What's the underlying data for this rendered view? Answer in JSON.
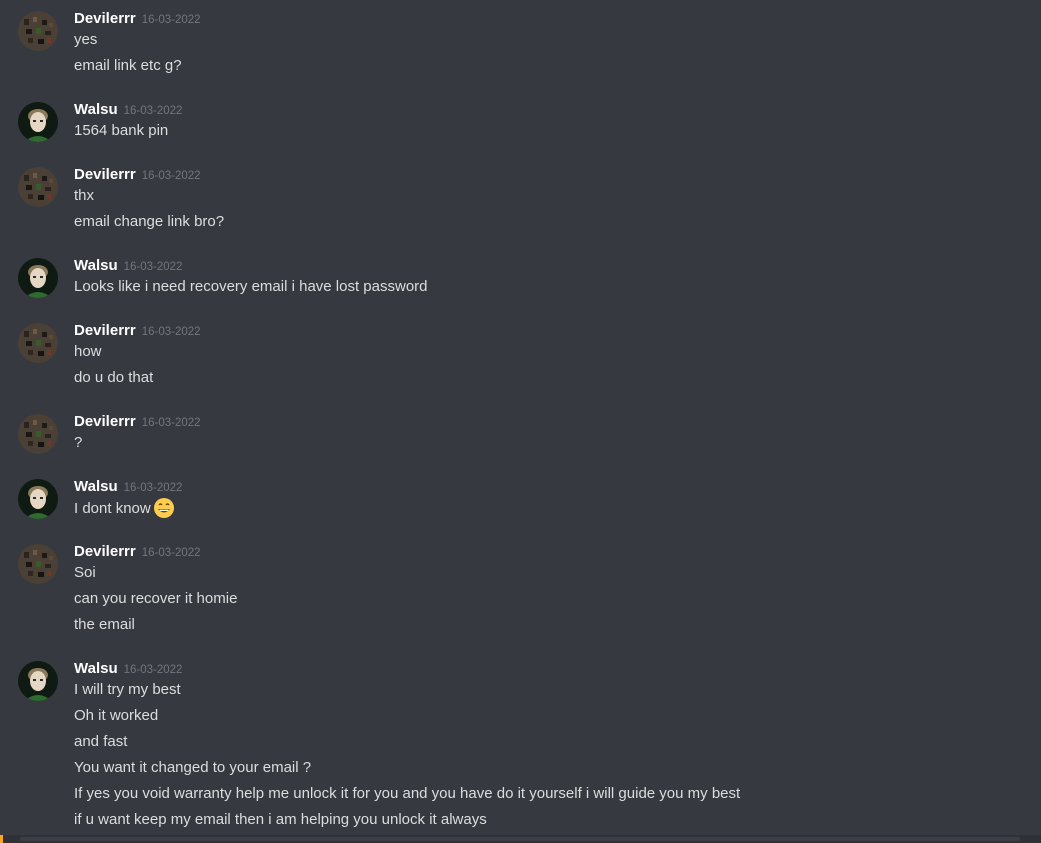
{
  "users": {
    "devilerrr": {
      "name": "Devilerrr",
      "avatar_icon": "devilerrr-avatar-icon"
    },
    "walsu": {
      "name": "Walsu",
      "avatar_icon": "walsu-avatar-icon"
    }
  },
  "colors": {
    "background": "#36393f",
    "username": "#ffffff",
    "timestamp": "#72767d",
    "message_text": "#dcddde",
    "bottom_accent": "#faa61a"
  },
  "messages": [
    {
      "author": "Devilerrr",
      "timestamp": "16-03-2022",
      "lines": [
        "yes",
        "email link etc g?"
      ]
    },
    {
      "author": "Walsu",
      "timestamp": "16-03-2022",
      "lines": [
        "1564 bank pin"
      ]
    },
    {
      "author": "Devilerrr",
      "timestamp": "16-03-2022",
      "lines": [
        "thx",
        "email change link bro?"
      ]
    },
    {
      "author": "Walsu",
      "timestamp": "16-03-2022",
      "lines": [
        "Looks like i need recovery email i have lost password"
      ]
    },
    {
      "author": "Devilerrr",
      "timestamp": "16-03-2022",
      "lines": [
        "how",
        "do u do that"
      ]
    },
    {
      "author": "Devilerrr",
      "timestamp": "16-03-2022",
      "lines": [
        "?"
      ]
    },
    {
      "author": "Walsu",
      "timestamp": "16-03-2022",
      "lines": [
        "I dont know"
      ],
      "emoji": "grinning-face-emoji"
    },
    {
      "author": "Devilerrr",
      "timestamp": "16-03-2022",
      "lines": [
        "Soi",
        "can you recover it homie",
        "the email"
      ]
    },
    {
      "author": "Walsu",
      "timestamp": "16-03-2022",
      "lines": [
        "I will try my best",
        "Oh it worked",
        "and fast",
        "You want it changed to your email ?",
        "If yes you void warranty help me unlock it for you and you have do it yourself i will guide you my best",
        "if u want keep my email then i am helping you unlock it always"
      ]
    }
  ]
}
